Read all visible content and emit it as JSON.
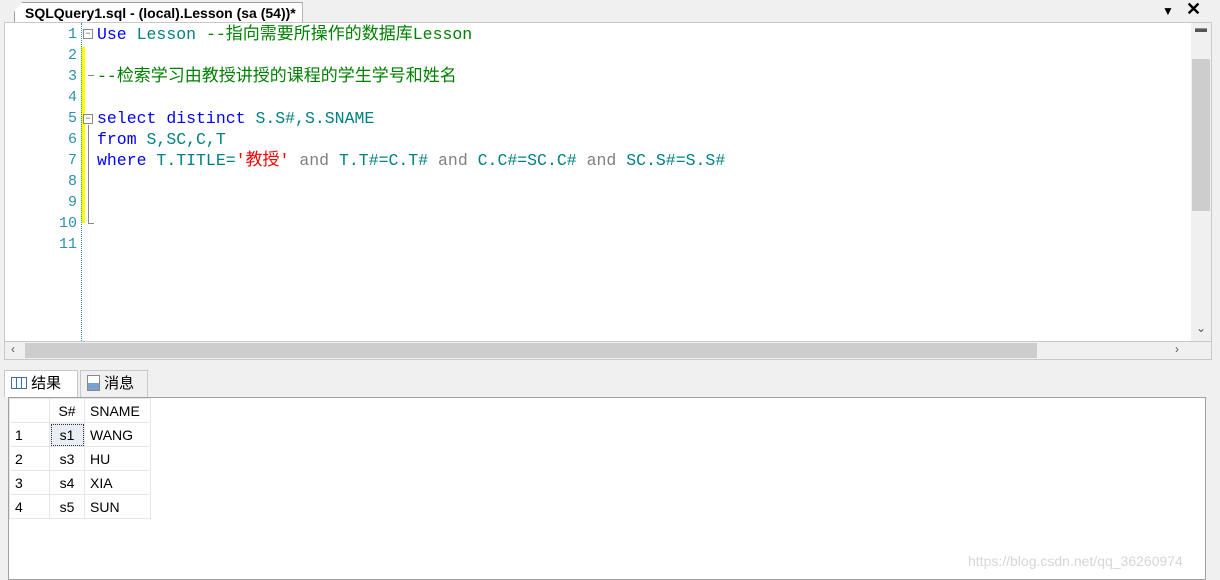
{
  "window": {
    "tab_title": "SQLQuery1.sql - (local).Lesson (sa (54))*",
    "dropdown_icon": "chevron-down-icon",
    "close_icon": "close-icon"
  },
  "editor": {
    "line_numbers": [
      "1",
      "2",
      "3",
      "4",
      "5",
      "6",
      "7",
      "8",
      "9",
      "10",
      "11"
    ],
    "lines": [
      [
        {
          "t": "Use",
          "c": "kw"
        },
        {
          "t": " "
        },
        {
          "t": "Lesson",
          "c": "id"
        },
        {
          "t": " --",
          "c": "cm"
        },
        {
          "t": "指向需要所操作的数据库",
          "c": "cm cjk"
        },
        {
          "t": "Lesson",
          "c": "cm"
        }
      ],
      [],
      [
        {
          "t": "--",
          "c": "cm"
        },
        {
          "t": "检索学习由教授讲授的课程的学生学号和姓名",
          "c": "cm cjk"
        }
      ],
      [],
      [
        {
          "t": "select",
          "c": "kw"
        },
        {
          "t": " "
        },
        {
          "t": "distinct",
          "c": "kw"
        },
        {
          "t": " "
        },
        {
          "t": "S.S#,S.SNAME",
          "c": "id"
        }
      ],
      [
        {
          "t": "from",
          "c": "kw"
        },
        {
          "t": " "
        },
        {
          "t": "S,SC,C,T",
          "c": "id"
        }
      ],
      [
        {
          "t": "where",
          "c": "kw"
        },
        {
          "t": " "
        },
        {
          "t": "T.TITLE=",
          "c": "id"
        },
        {
          "t": "'",
          "c": "st"
        },
        {
          "t": "教授",
          "c": "st cjk"
        },
        {
          "t": "'",
          "c": "st"
        },
        {
          "t": " "
        },
        {
          "t": "and",
          "c": "op"
        },
        {
          "t": " "
        },
        {
          "t": "T.T#=C.T#",
          "c": "id"
        },
        {
          "t": " "
        },
        {
          "t": "and",
          "c": "op"
        },
        {
          "t": " "
        },
        {
          "t": "C.C#=SC.C#",
          "c": "id"
        },
        {
          "t": " "
        },
        {
          "t": "and",
          "c": "op"
        },
        {
          "t": " "
        },
        {
          "t": "SC.S#=S.S#",
          "c": "id"
        }
      ],
      [],
      [],
      [],
      []
    ]
  },
  "results": {
    "tabs": [
      {
        "label": "结果",
        "icon": "grid-icon",
        "active": true
      },
      {
        "label": "消息",
        "icon": "messages-icon",
        "active": false
      }
    ],
    "columns": [
      "S#",
      "SNAME"
    ],
    "rows": [
      {
        "n": "1",
        "s": "s1",
        "name": "WANG"
      },
      {
        "n": "2",
        "s": "s3",
        "name": "HU"
      },
      {
        "n": "3",
        "s": "s4",
        "name": "XIA"
      },
      {
        "n": "4",
        "s": "s5",
        "name": "SUN"
      }
    ]
  },
  "watermark": "https://blog.csdn.net/qq_36260974"
}
